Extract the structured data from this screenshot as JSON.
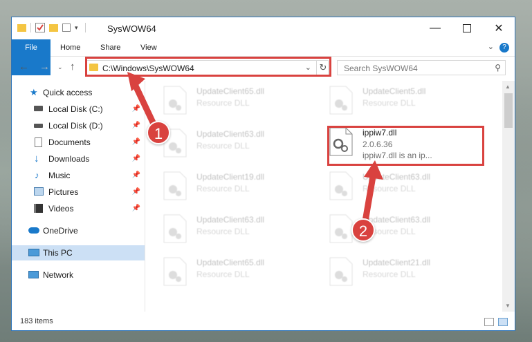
{
  "window": {
    "title": "SysWOW64"
  },
  "ribbon": {
    "tabs": [
      "File",
      "Home",
      "Share",
      "View"
    ]
  },
  "address": {
    "path": "C:\\Windows\\SysWOW64"
  },
  "search": {
    "placeholder": "Search SysWOW64"
  },
  "sidebar": {
    "items": [
      {
        "label": "Quick access",
        "icon": "star-icon"
      },
      {
        "label": "Local Disk (C:)",
        "icon": "drive-icon"
      },
      {
        "label": "Local Disk (D:)",
        "icon": "drive-icon"
      },
      {
        "label": "Documents",
        "icon": "documents-icon"
      },
      {
        "label": "Downloads",
        "icon": "download-icon"
      },
      {
        "label": "Music",
        "icon": "music-icon"
      },
      {
        "label": "Pictures",
        "icon": "pictures-icon"
      },
      {
        "label": "Videos",
        "icon": "videos-icon"
      },
      {
        "label": "OneDrive",
        "icon": "cloud-icon"
      },
      {
        "label": "This PC",
        "icon": "computer-icon"
      },
      {
        "label": "Network",
        "icon": "network-icon"
      }
    ]
  },
  "files": [
    {
      "name": "UpdateClient65.dll",
      "sub": "Resource DLL"
    },
    {
      "name": "UpdateClient5.dll",
      "sub": "Resource DLL"
    },
    {
      "name": "UpdateClient63.dll",
      "sub": "Resource DLL"
    },
    {
      "name": "ippiw7.dll",
      "sub": "2.0.6.36",
      "sub2": "ippiw7.dll is an ip..."
    },
    {
      "name": "UpdateClient19.dll",
      "sub": "Resource DLL"
    },
    {
      "name": "UpdateClient63.dll",
      "sub": "Resource DLL"
    },
    {
      "name": "UpdateClient63.dll",
      "sub": "Resource DLL"
    },
    {
      "name": "UpdateClient63.dll",
      "sub": "Resource DLL"
    },
    {
      "name": "UpdateClient65.dll",
      "sub": "Resource DLL"
    },
    {
      "name": "UpdateClient21.dll",
      "sub": "Resource DLL"
    }
  ],
  "status": {
    "count": "183 items"
  },
  "annotations": {
    "step1": "1",
    "step2": "2"
  },
  "colors": {
    "accent": "#1979ca",
    "highlight": "#d9423f"
  }
}
